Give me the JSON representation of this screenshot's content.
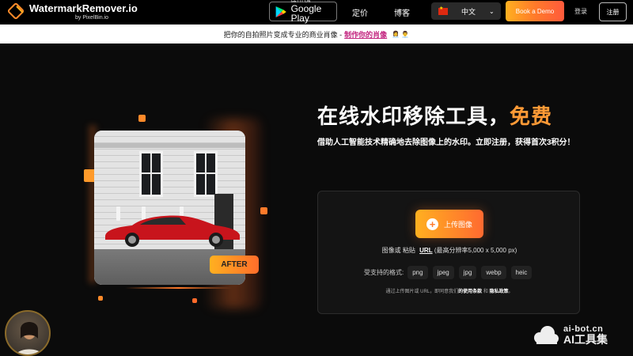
{
  "header": {
    "logo_title": "WatermarkRemover.io",
    "logo_sub": "by PixelBin.io",
    "gplay_small": "GET IT ON",
    "gplay_big": "Google Play",
    "nav_pricing": "定价",
    "nav_blog": "博客",
    "language": "中文",
    "demo_button": "Book a Demo",
    "login": "登录",
    "register": "注册"
  },
  "announcement": {
    "text": "把你的自拍照片变成专业的商业肖像 - ",
    "link": "制作你的肖像",
    "emoji": "👩‍💼 👨‍💼"
  },
  "hero": {
    "title_main": "在线水印移除工具，",
    "title_accent": "免费",
    "subtitle": "借助人工智能技术精确地去除图像上的水印。立即注册，获得首次3积分！"
  },
  "preview": {
    "after_badge": "AFTER"
  },
  "upload": {
    "button_label": "上传图像",
    "hint_prefix": "图像或 粘贴",
    "hint_url": "URL",
    "hint_suffix": "(最高分辨率5,000 x 5,000 px)",
    "formats_label": "受支持的格式:",
    "formats": [
      "png",
      "jpeg",
      "jpg",
      "webp",
      "heic"
    ],
    "terms_prefix": "通过上传图片或 URL，即同意我们",
    "terms_link1": "的使用条款",
    "terms_mid": " 和 ",
    "terms_link2": "隐私政策",
    "terms_suffix": "。"
  },
  "watermark": {
    "line1": "ai-bot.cn",
    "line2": "AI工具集"
  },
  "colors": {
    "accent_orange": "#ff9a36",
    "link_pink": "#c2227e",
    "background": "#0b0b0b"
  }
}
